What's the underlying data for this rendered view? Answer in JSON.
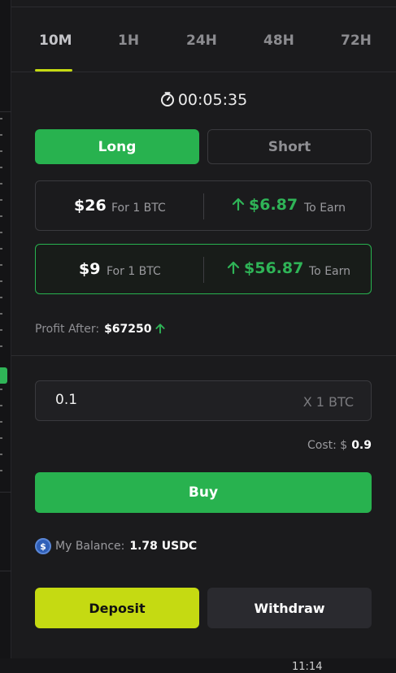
{
  "tabs": [
    {
      "label": "10M",
      "active": true
    },
    {
      "label": "1H",
      "active": false
    },
    {
      "label": "24H",
      "active": false
    },
    {
      "label": "48H",
      "active": false
    },
    {
      "label": "72H",
      "active": false
    }
  ],
  "timer": {
    "icon": "stopwatch-icon",
    "value": "00:05:35"
  },
  "direction": {
    "long_label": "Long",
    "short_label": "Short",
    "selected": "Long"
  },
  "offers": [
    {
      "price": "$26",
      "for_label": "For 1 BTC",
      "earn": "$6.87",
      "earn_label": "To Earn",
      "selected": false
    },
    {
      "price": "$9",
      "for_label": "For 1 BTC",
      "earn": "$56.87",
      "earn_label": "To Earn",
      "selected": true
    }
  ],
  "profit": {
    "label": "Profit After:",
    "value": "$67250"
  },
  "quantity": {
    "value": "0.1",
    "unit": "X 1 BTC"
  },
  "cost": {
    "label": "Cost: $",
    "value": "0.9"
  },
  "buy_label": "Buy",
  "balance": {
    "icon": "usdc-coin-icon",
    "label": "My Balance:",
    "value": "1.78 USDC"
  },
  "deposit_label": "Deposit",
  "withdraw_label": "Withdraw",
  "clock": "11:14",
  "colors": {
    "accent_green": "#28b24f",
    "accent_lime": "#c5da12",
    "background": "#1b1b1d"
  }
}
